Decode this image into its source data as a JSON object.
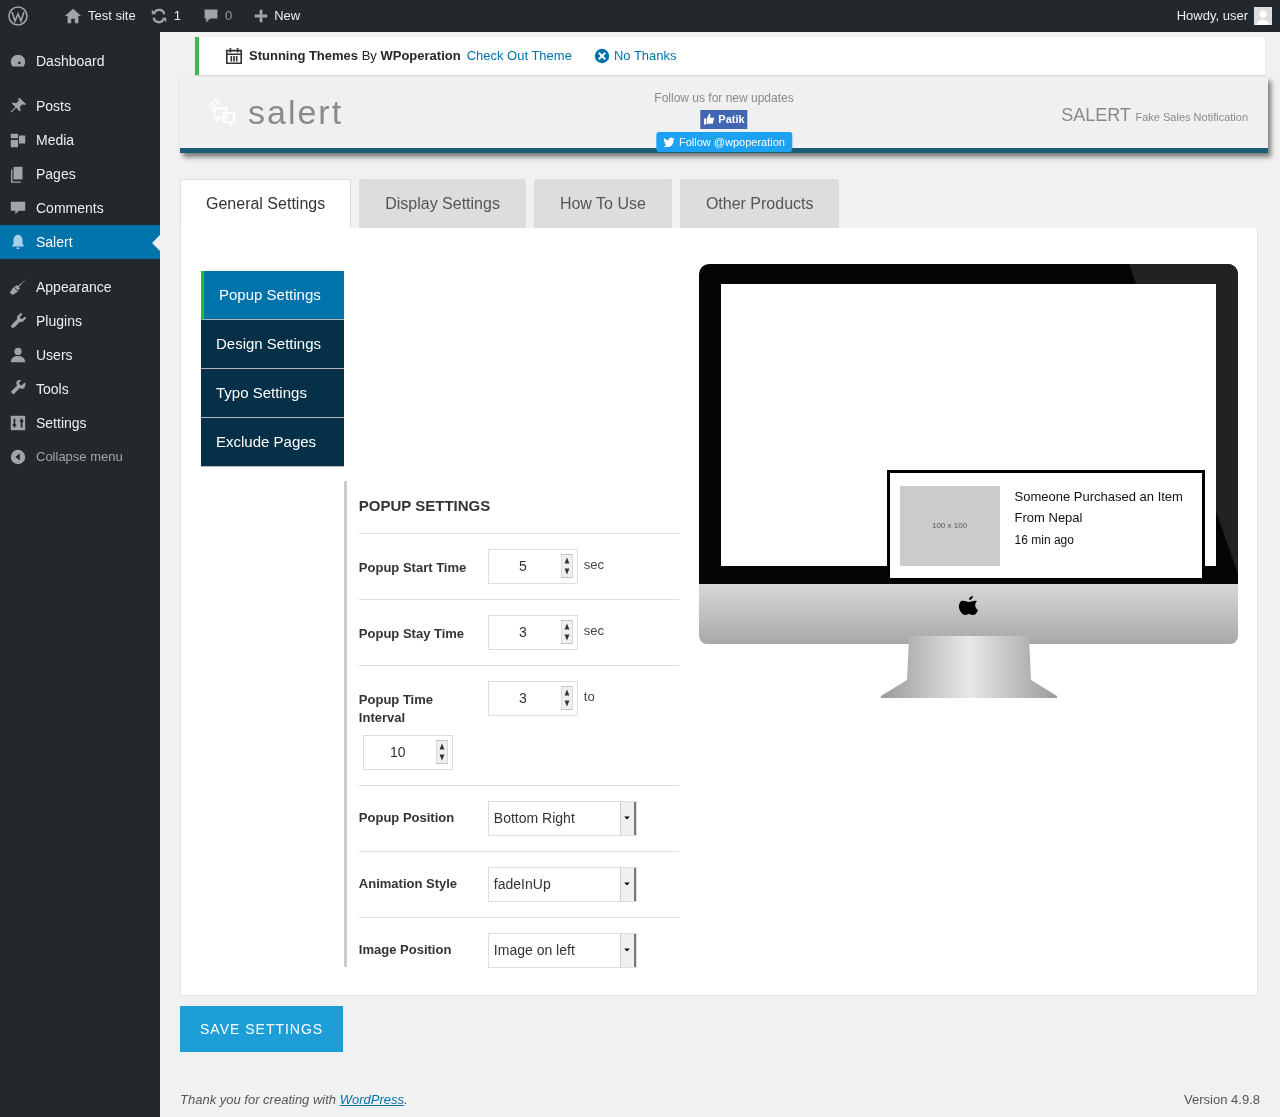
{
  "admin_bar": {
    "site": "Test site",
    "updates": "1",
    "comments": "0",
    "new": "New",
    "greeting": "Howdy, user"
  },
  "sidebar": {
    "groups": [
      [
        {
          "label": "Dashboard",
          "selected": false
        }
      ],
      [
        {
          "label": "Posts",
          "selected": false
        },
        {
          "label": "Media",
          "selected": false
        },
        {
          "label": "Pages",
          "selected": false
        },
        {
          "label": "Comments",
          "selected": false
        },
        {
          "label": "Salert",
          "selected": true
        }
      ],
      [
        {
          "label": "Appearance",
          "selected": false
        },
        {
          "label": "Plugins",
          "selected": false
        },
        {
          "label": "Users",
          "selected": false
        },
        {
          "label": "Tools",
          "selected": false
        },
        {
          "label": "Settings",
          "selected": false
        }
      ]
    ],
    "collapse": "Collapse menu"
  },
  "notice": {
    "text": "**Stunning Themes** By **WPoperation**",
    "link": "Check Out Theme",
    "dismiss": "No Thanks"
  },
  "banner": {
    "logo": "salert",
    "follow_text": "Follow us for new updates",
    "like_button": "Patik",
    "twitter_button": "Follow @wpoperation",
    "product": "SALERT",
    "tagline": "Fake Sales Notification"
  },
  "tabs": [
    {
      "label": "General Settings",
      "selected": true
    },
    {
      "label": "Display Settings",
      "selected": false
    },
    {
      "label": "How To Use",
      "selected": false
    },
    {
      "label": "Other Products",
      "selected": false
    }
  ],
  "subnav": [
    {
      "label": "Popup Settings",
      "selected": true
    },
    {
      "label": "Design Settings",
      "selected": false
    },
    {
      "label": "Typo Settings",
      "selected": false
    },
    {
      "label": "Exclude Pages",
      "selected": false
    }
  ],
  "form": {
    "title": "POPUP SETTINGS",
    "rows": [
      {
        "kind": "number",
        "label": "Popup Start Time",
        "value": "5",
        "unit": "sec"
      },
      {
        "kind": "number",
        "label": "Popup Stay Time",
        "value": "3",
        "unit": "sec"
      },
      {
        "kind": "range",
        "label": "Popup Time Interval",
        "value": "3",
        "unit": "to",
        "value2": "10"
      },
      {
        "kind": "select",
        "label": "Popup Position",
        "value": "Bottom Right"
      },
      {
        "kind": "select",
        "label": "Animation Style",
        "value": "fadeInUp"
      },
      {
        "kind": "select",
        "label": "Image Position",
        "value": "Image on left"
      }
    ]
  },
  "preview": {
    "image_placeholder": "100 x 100",
    "title": "Someone Purchased an Item",
    "location": "From Nepal",
    "time": "16 min ago"
  },
  "save_button": "SAVE SETTINGS",
  "footer": {
    "thanks": "Thank you for creating with",
    "link": "WordPress",
    "after": ".",
    "version": "Version 4.9.8"
  }
}
